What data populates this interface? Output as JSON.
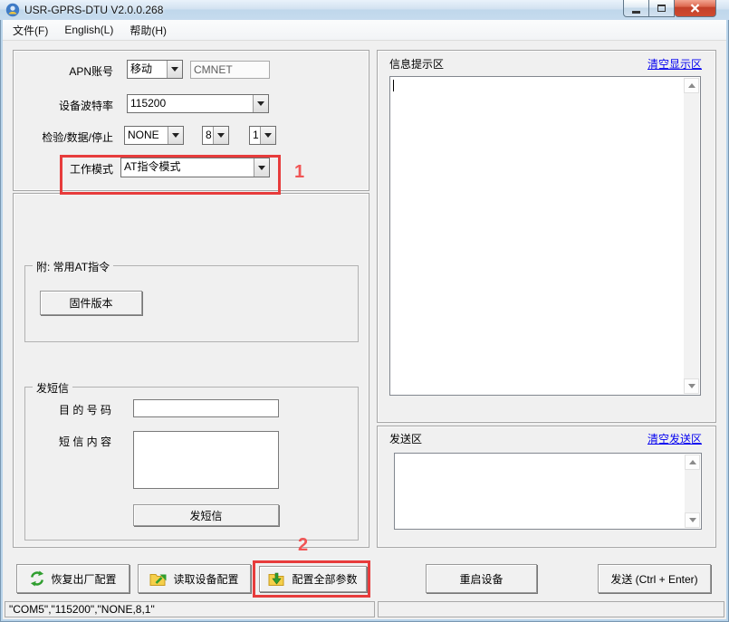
{
  "window": {
    "title": "USR-GPRS-DTU V2.0.0.268"
  },
  "menu": {
    "items": [
      {
        "label": "文件(F)"
      },
      {
        "label": "English(L)"
      },
      {
        "label": "帮助(H)"
      }
    ]
  },
  "config": {
    "apn_label": "APN账号",
    "apn_value": "移动",
    "apn_code": "CMNET",
    "baud_label": "设备波特率",
    "baud_value": "115200",
    "parity_label": "检验/数据/停止",
    "parity_value": "NONE",
    "databits_value": "8",
    "stopbits_value": "1",
    "workmode_label": "工作模式",
    "workmode_value": "AT指令模式"
  },
  "at_group": {
    "title": "附: 常用AT指令",
    "firmware_button": "固件版本"
  },
  "sms_group": {
    "title": "发短信",
    "phone_label": "目 的 号 码",
    "content_label": "短 信 内 容",
    "phone_value": "",
    "content_value": "",
    "send_button": "发短信"
  },
  "info_panel": {
    "title": "信息提示区",
    "clear_link": "清空显示区",
    "content": ""
  },
  "send_panel": {
    "title": "发送区",
    "clear_link": "清空发送区",
    "content": ""
  },
  "actions": {
    "restore": "恢复出厂配置",
    "read": "读取设备配置",
    "configure": "配置全部参数",
    "restart": "重启设备",
    "send": "发送 (Ctrl + Enter)"
  },
  "annotations": {
    "step1": "1",
    "step2": "2",
    "highlight_color": "#e73c3c"
  },
  "status_bar": {
    "left": "\"COM5\",\"115200\",\"NONE,8,1\"",
    "right": ""
  },
  "icons": {
    "app": "app-icon",
    "restore": "recycle-arrows-icon",
    "read": "folder-export-icon",
    "configure": "folder-import-icon"
  },
  "colors": {
    "link": "#0502f0",
    "accent_red": "#e73c3c",
    "folder": "#f5cf4a",
    "green": "#2f9e2f"
  }
}
